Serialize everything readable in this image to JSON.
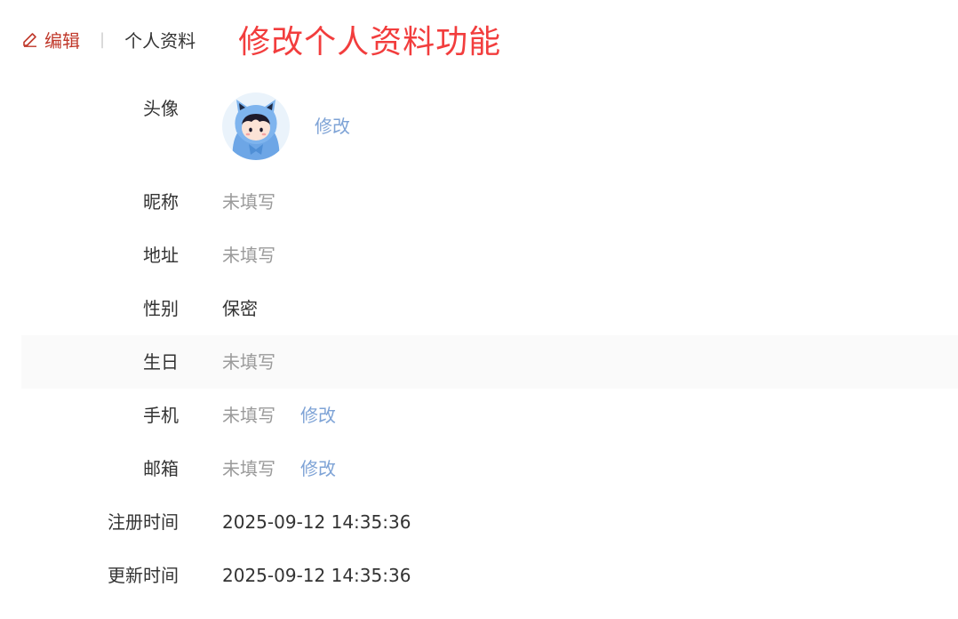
{
  "header": {
    "edit_label": "编辑",
    "divider": "|",
    "crumb": "个人资料",
    "headline": "修改个人资料功能"
  },
  "profile": {
    "avatar": {
      "label": "头像",
      "action": "修改"
    },
    "nickname": {
      "label": "昵称",
      "value": "未填写"
    },
    "address": {
      "label": "地址",
      "value": "未填写"
    },
    "gender": {
      "label": "性别",
      "value": "保密"
    },
    "birthday": {
      "label": "生日",
      "value": "未填写"
    },
    "phone": {
      "label": "手机",
      "value": "未填写",
      "action": "修改"
    },
    "email": {
      "label": "邮箱",
      "value": "未填写",
      "action": "修改"
    },
    "registered": {
      "label": "注册时间",
      "value": "2025-09-12 14:35:36"
    },
    "updated": {
      "label": "更新时间",
      "value": "2025-09-12 14:35:36"
    }
  },
  "colors": {
    "accent_red": "#f23d3d",
    "edit_red": "#c0392b",
    "link_blue": "#7ea3d6",
    "placeholder_gray": "#9a9a9a"
  },
  "icons": [
    "edit-pencil-icon",
    "avatar-cat-hood-illustration"
  ]
}
